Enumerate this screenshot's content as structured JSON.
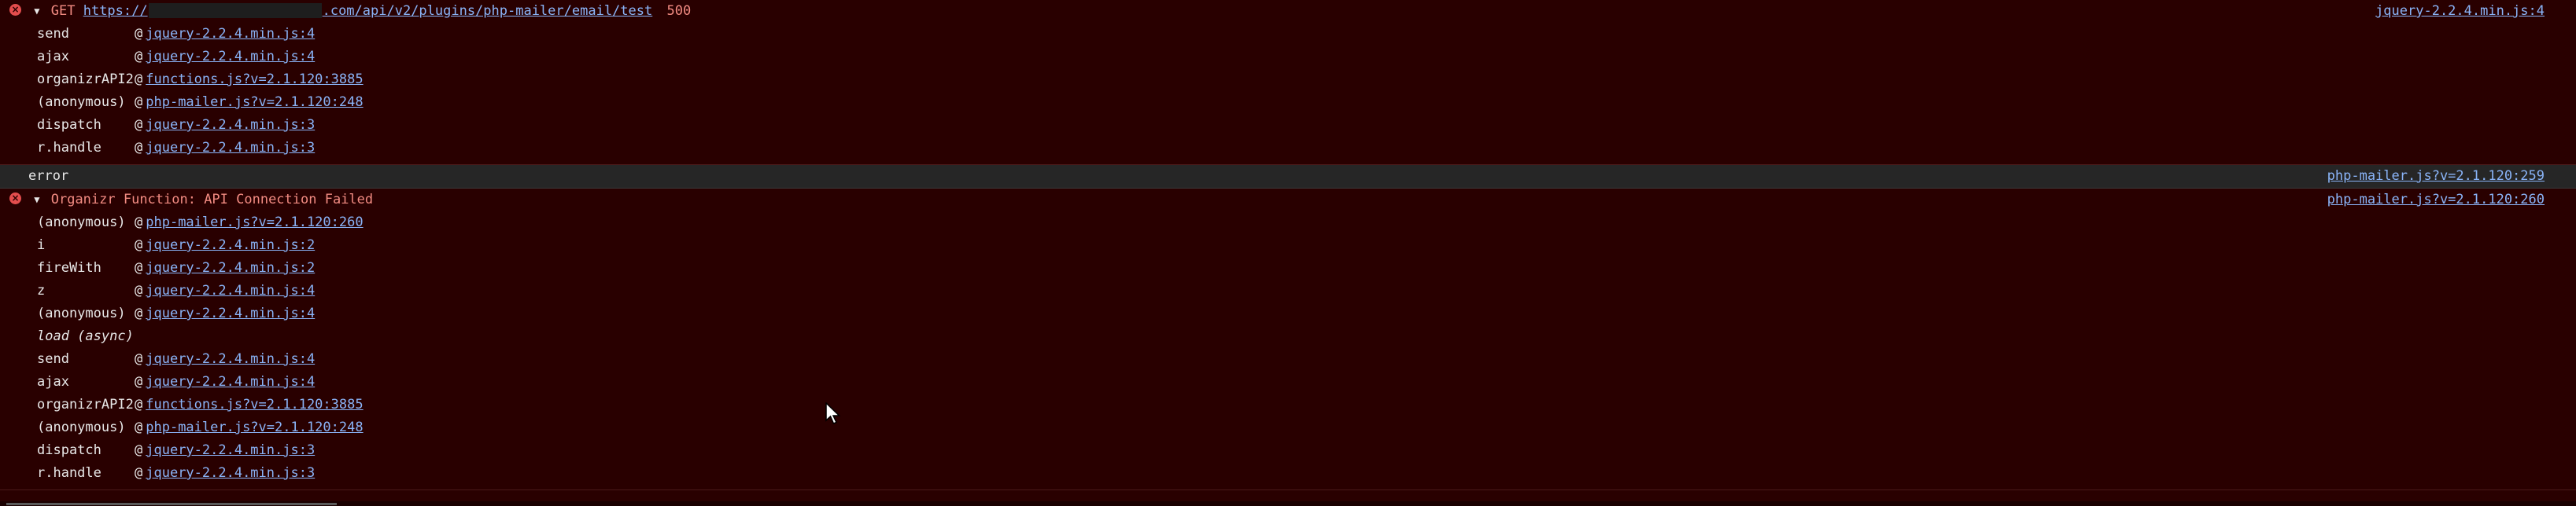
{
  "block1": {
    "method": "GET",
    "url_prefix": "https://",
    "url_suffix": ".com/api/v2/plugins/php-mailer/email/test",
    "status": "500",
    "source": "jquery-2.2.4.min.js:4",
    "frames": [
      {
        "fn": "send",
        "loc": "jquery-2.2.4.min.js:4"
      },
      {
        "fn": "ajax",
        "loc": "jquery-2.2.4.min.js:4"
      },
      {
        "fn": "organizrAPI2",
        "loc": "functions.js?v=2.1.120:3885"
      },
      {
        "fn": "(anonymous)",
        "loc": "php-mailer.js?v=2.1.120:248"
      },
      {
        "fn": "dispatch",
        "loc": "jquery-2.2.4.min.js:3"
      },
      {
        "fn": "r.handle",
        "loc": "jquery-2.2.4.min.js:3"
      }
    ]
  },
  "log": {
    "text": "error",
    "source": "php-mailer.js?v=2.1.120:259"
  },
  "block2": {
    "message": "Organizr Function: API Connection Failed",
    "source": "php-mailer.js?v=2.1.120:260",
    "frames_a": [
      {
        "fn": "(anonymous)",
        "loc": "php-mailer.js?v=2.1.120:260"
      },
      {
        "fn": "i",
        "loc": "jquery-2.2.4.min.js:2"
      },
      {
        "fn": "fireWith",
        "loc": "jquery-2.2.4.min.js:2"
      },
      {
        "fn": "z",
        "loc": "jquery-2.2.4.min.js:4"
      },
      {
        "fn": "(anonymous)",
        "loc": "jquery-2.2.4.min.js:4"
      }
    ],
    "async_label": "load (async)",
    "frames_b": [
      {
        "fn": "send",
        "loc": "jquery-2.2.4.min.js:4"
      },
      {
        "fn": "ajax",
        "loc": "jquery-2.2.4.min.js:4"
      },
      {
        "fn": "organizrAPI2",
        "loc": "functions.js?v=2.1.120:3885"
      },
      {
        "fn": "(anonymous)",
        "loc": "php-mailer.js?v=2.1.120:248"
      },
      {
        "fn": "dispatch",
        "loc": "jquery-2.2.4.min.js:3"
      },
      {
        "fn": "r.handle",
        "loc": "jquery-2.2.4.min.js:3"
      }
    ]
  },
  "icons": {
    "error": "error-icon",
    "expand": "triangle-down-icon",
    "cursor": "mouse-pointer-icon"
  },
  "colors": {
    "background": "#290000",
    "error_text": "#f28b82",
    "link": "#8ab4f8"
  }
}
